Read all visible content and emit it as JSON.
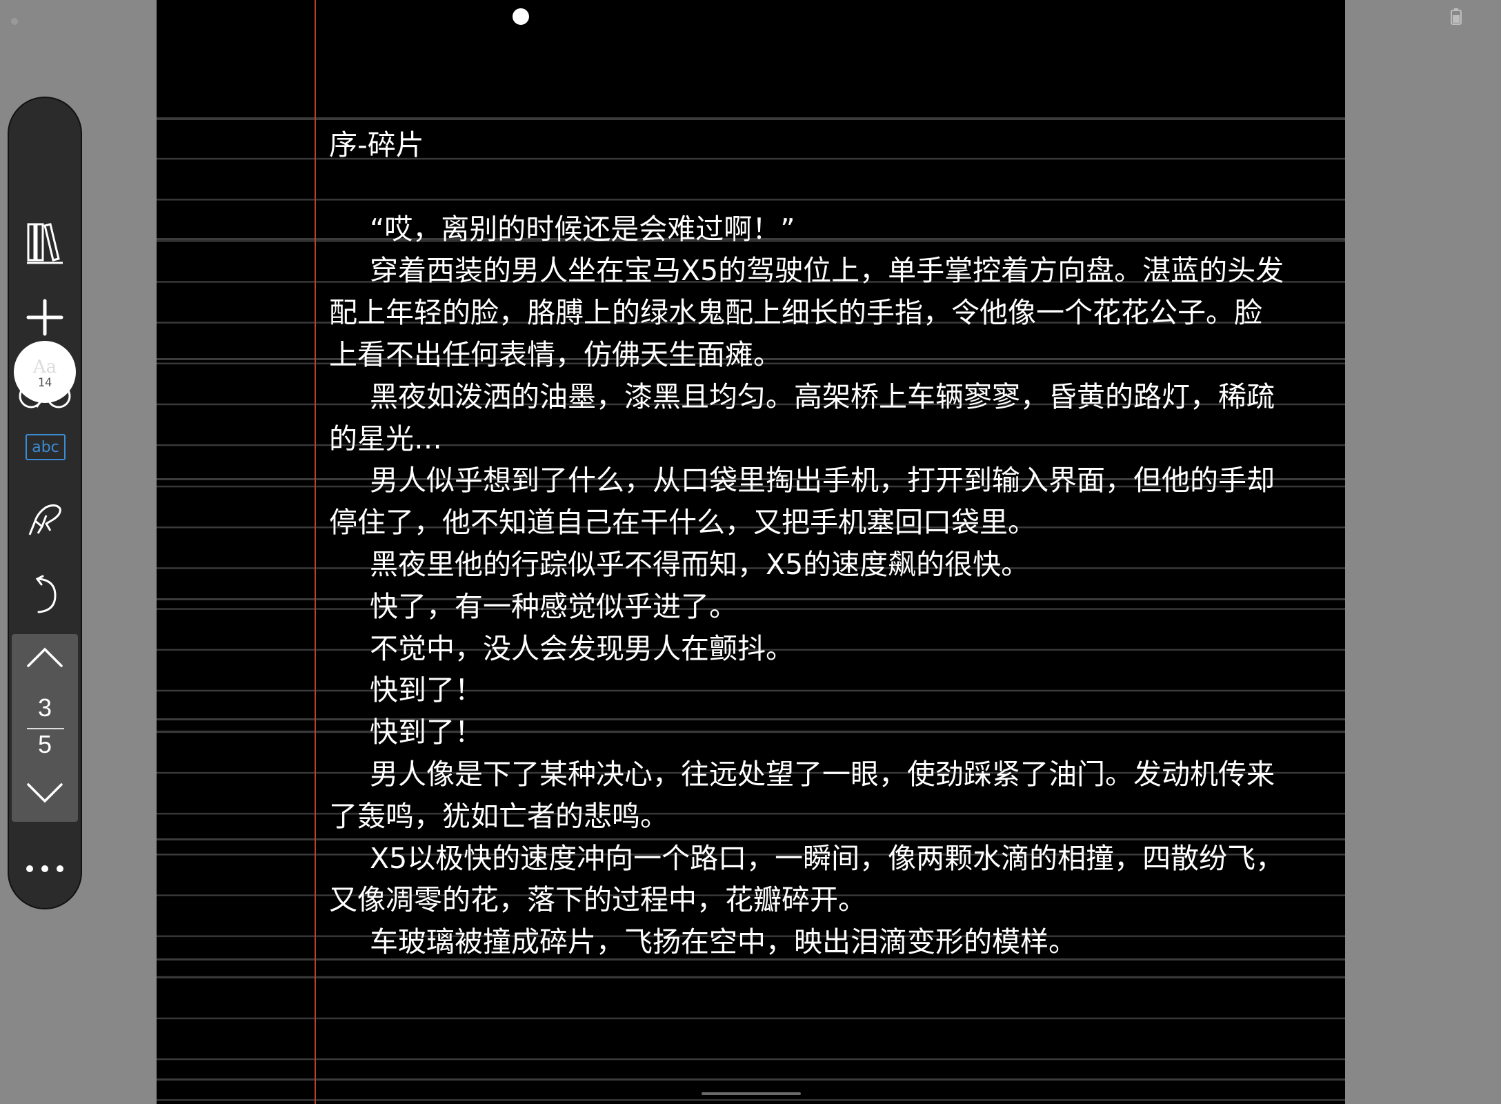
{
  "toolbar": {
    "items": [
      {
        "name": "library",
        "icon": "books-icon"
      },
      {
        "name": "add",
        "icon": "plus-icon"
      },
      {
        "name": "reading-mode",
        "icon": "glasses-icon"
      },
      {
        "name": "font-size",
        "label": "Aa",
        "value": "14"
      },
      {
        "name": "spellcheck",
        "label": "abc"
      },
      {
        "name": "handwriting",
        "icon": "pen-hand-icon"
      },
      {
        "name": "undo",
        "icon": "undo-icon"
      }
    ],
    "font": {
      "label": "Aa",
      "size": "14"
    },
    "abc_label": "abc",
    "pager": {
      "current": "3",
      "total": "5"
    },
    "more_icon": "ellipsis-icon"
  },
  "colors": {
    "page_background": "#000000",
    "outer_background": "#888888",
    "margin_line": "#b8402e",
    "rule_line": "#3a3a3a",
    "text": "#ffffff",
    "toolbar": "#2b2b2b",
    "accent": "#3b8bd6"
  },
  "document": {
    "chapter_title": "序-碎片",
    "paragraphs": [
      "“哎，离别的时候还是会难过啊！”",
      "穿着西装的男人坐在宝马X5的驾驶位上，单手掌控着方向盘。湛蓝的头发配上年轻的脸，胳膊上的绿水鬼配上细长的手指，令他像一个花花公子。脸上看不出任何表情，仿佛天生面瘫。",
      "黑夜如泼洒的油墨，漆黑且均匀。高架桥上车辆寥寥，昏黄的路灯，稀疏的星光…",
      "男人似乎想到了什么，从口袋里掏出手机，打开到输入界面，但他的手却停住了，他不知道自己在干什么，又把手机塞回口袋里。",
      "黑夜里他的行踪似乎不得而知，X5的速度飙的很快。",
      "快了，有一种感觉似乎进了。",
      "不觉中，没人会发现男人在颤抖。",
      "快到了！",
      "快到了！",
      "男人像是下了某种决心，往远处望了一眼，使劲踩紧了油门。发动机传来了轰鸣，犹如亡者的悲鸣。",
      "X5以极快的速度冲向一个路口，一瞬间，像两颗水滴的相撞，四散纷飞，又像凋零的花，落下的过程中，花瓣碎开。",
      "车玻璃被撞成碎片，飞扬在空中，映出泪滴变形的模样。"
    ]
  },
  "status": {
    "battery_icon": "battery-icon"
  }
}
